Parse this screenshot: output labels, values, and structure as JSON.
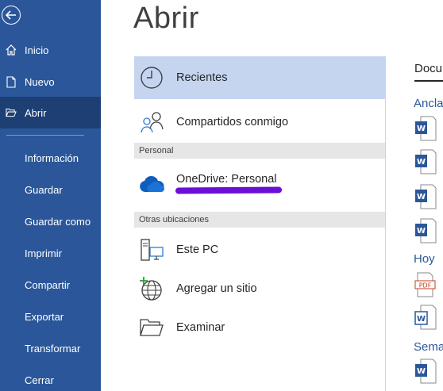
{
  "sidebar": {
    "items": [
      {
        "label": "Inicio",
        "icon": "home-icon"
      },
      {
        "label": "Nuevo",
        "icon": "new-document-icon"
      },
      {
        "label": "Abrir",
        "icon": "folder-open-icon",
        "active": true
      },
      {
        "label": "Información"
      },
      {
        "label": "Guardar"
      },
      {
        "label": "Guardar como"
      },
      {
        "label": "Imprimir"
      },
      {
        "label": "Compartir"
      },
      {
        "label": "Exportar"
      },
      {
        "label": "Transformar"
      },
      {
        "label": "Cerrar"
      }
    ]
  },
  "main": {
    "title": "Abrir",
    "locations": {
      "recent": "Recientes",
      "shared": "Compartidos conmigo",
      "section_personal": "Personal",
      "onedrive": "OneDrive: Personal",
      "section_other": "Otras ubicaciones",
      "this_pc": "Este PC",
      "add_place": "Agregar un sitio",
      "browse": "Examinar"
    }
  },
  "right_pane": {
    "header": "Docu",
    "groups": {
      "pinned": "Ancla",
      "today": "Hoy",
      "week": "Sema"
    }
  },
  "colors": {
    "sidebar": "#2b579a",
    "sidebar_active": "#1d3f73",
    "selected_location": "#c5d5ef",
    "accent_blue": "#2b579a",
    "redaction": "#6b0fd6"
  }
}
